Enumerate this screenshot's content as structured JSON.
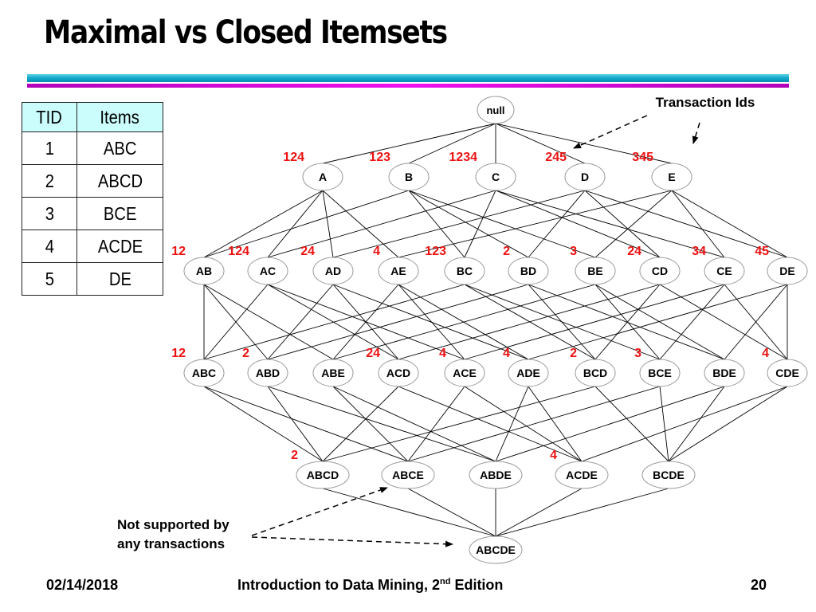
{
  "slide": {
    "title": "Maximal vs Closed Itemsets",
    "footer": {
      "date": "02/14/2018",
      "course": "Introduction to Data Mining, 2",
      "course_sup": "nd",
      "course_suffix": " Edition",
      "page": "20"
    }
  },
  "transactions": {
    "headers": [
      "TID",
      "Items"
    ],
    "rows": [
      {
        "tid": "1",
        "items": "ABC"
      },
      {
        "tid": "2",
        "items": "ABCD"
      },
      {
        "tid": "3",
        "items": "BCE"
      },
      {
        "tid": "4",
        "items": "ACDE"
      },
      {
        "tid": "5",
        "items": "DE"
      }
    ]
  },
  "lattice": {
    "colors": {
      "tid_label": "#ee1111",
      "edge": "#000000",
      "node_border": "#999999"
    },
    "levels": [
      [
        {
          "name": "null",
          "tids": ""
        }
      ],
      [
        {
          "name": "A",
          "tids": "124"
        },
        {
          "name": "B",
          "tids": "123"
        },
        {
          "name": "C",
          "tids": "1234"
        },
        {
          "name": "D",
          "tids": "245"
        },
        {
          "name": "E",
          "tids": "345"
        }
      ],
      [
        {
          "name": "AB",
          "tids": "12"
        },
        {
          "name": "AC",
          "tids": "124"
        },
        {
          "name": "AD",
          "tids": "24"
        },
        {
          "name": "AE",
          "tids": "4"
        },
        {
          "name": "BC",
          "tids": "123"
        },
        {
          "name": "BD",
          "tids": "2"
        },
        {
          "name": "BE",
          "tids": "3"
        },
        {
          "name": "CD",
          "tids": "24"
        },
        {
          "name": "CE",
          "tids": "34"
        },
        {
          "name": "DE",
          "tids": "45"
        }
      ],
      [
        {
          "name": "ABC",
          "tids": "12"
        },
        {
          "name": "ABD",
          "tids": "2"
        },
        {
          "name": "ABE",
          "tids": ""
        },
        {
          "name": "ACD",
          "tids": "24"
        },
        {
          "name": "ACE",
          "tids": "4"
        },
        {
          "name": "ADE",
          "tids": "4"
        },
        {
          "name": "BCD",
          "tids": "2"
        },
        {
          "name": "BCE",
          "tids": "3"
        },
        {
          "name": "BDE",
          "tids": ""
        },
        {
          "name": "CDE",
          "tids": "4"
        }
      ],
      [
        {
          "name": "ABCD",
          "tids": "2"
        },
        {
          "name": "ABCE",
          "tids": ""
        },
        {
          "name": "ABDE",
          "tids": ""
        },
        {
          "name": "ACDE",
          "tids": "4"
        },
        {
          "name": "BCDE",
          "tids": ""
        }
      ],
      [
        {
          "name": "ABCDE",
          "tids": ""
        }
      ]
    ]
  },
  "annotations": {
    "transaction_ids": "Transaction Ids",
    "not_supported_line1": "Not supported by",
    "not_supported_line2": "any transactions"
  }
}
